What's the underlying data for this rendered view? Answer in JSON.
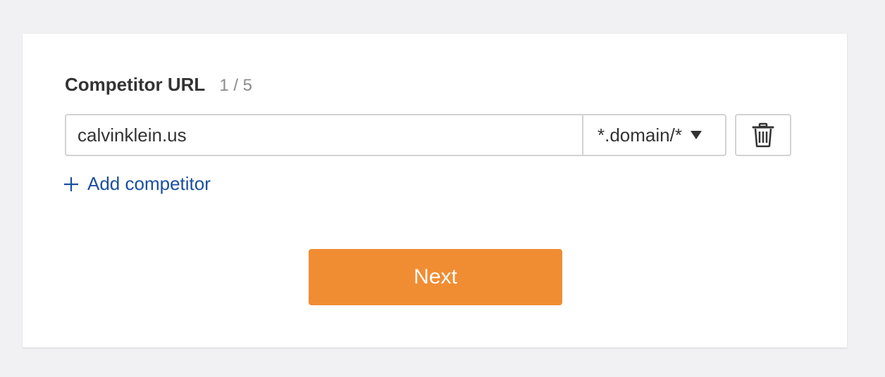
{
  "form": {
    "title": "Competitor URL",
    "count": "1 / 5",
    "url_value": "calvinklein.us",
    "scope_value": "*.domain/*",
    "add_label": "Add competitor",
    "next_label": "Next"
  },
  "icons": {
    "delete": "trash-icon",
    "scope_dropdown": "caret-down-icon",
    "add": "plus-icon"
  },
  "colors": {
    "primary_button": "#f08d33",
    "link": "#1b4fa0",
    "background": "#f1f1f3"
  }
}
